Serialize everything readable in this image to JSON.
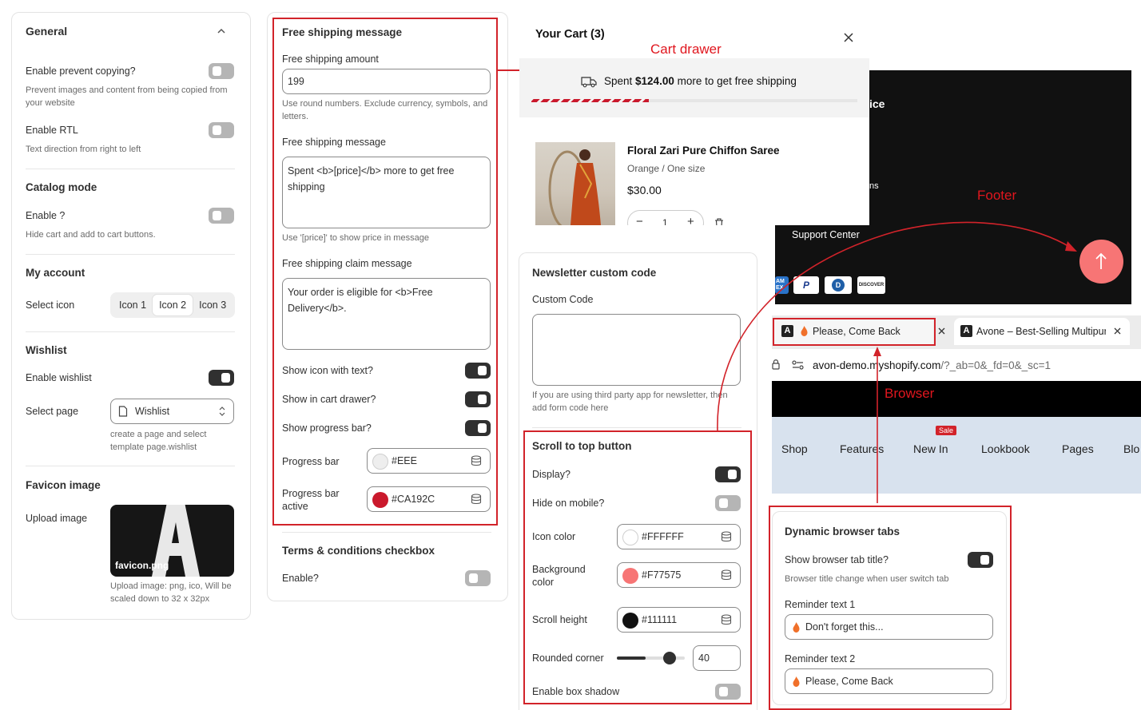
{
  "general": {
    "title": "General",
    "prevent_copy_label": "Enable prevent copying?",
    "prevent_copy_help": "Prevent images and content from being copied from your website",
    "rtl_label": "Enable RTL",
    "rtl_help": "Text direction from right to left"
  },
  "catalog": {
    "title": "Catalog mode",
    "enable_label": "Enable ?",
    "help": "Hide cart and add to cart buttons."
  },
  "account": {
    "title": "My account",
    "select_icon_label": "Select icon",
    "icons": [
      "Icon 1",
      "Icon 2",
      "Icon 3"
    ]
  },
  "wishlist": {
    "title": "Wishlist",
    "enable_label": "Enable wishlist",
    "select_page_label": "Select page",
    "select_value": "Wishlist",
    "help": "create a page and select template page.wishlist"
  },
  "favicon": {
    "title": "Favicon image",
    "upload_label": "Upload image",
    "file_name": "favicon.png",
    "help": "Upload image: png, ico, Will be scaled down to 32 x 32px"
  },
  "free_shipping": {
    "title": "Free shipping message",
    "amount_label": "Free shipping amount",
    "amount_value": "199",
    "amount_help": "Use round numbers. Exclude currency, symbols, and letters.",
    "message_label": "Free shipping message",
    "message_value": "Spent <b>[price]</b> more to get free shipping",
    "message_help": "Use '[price]' to show price in message",
    "claim_label": "Free shipping claim message",
    "claim_value": "Your order is eligible for <b>Free Delivery</b>.",
    "show_icon_label": "Show icon with text?",
    "show_drawer_label": "Show in cart drawer?",
    "show_progress_label": "Show progress bar?",
    "progress_label": "Progress bar",
    "progress_color": "#EEE",
    "progress_active_label": "Progress bar active",
    "progress_active_color": "#CA192C"
  },
  "terms": {
    "title": "Terms & conditions checkbox",
    "enable_label": "Enable?"
  },
  "cart": {
    "title": "Your Cart (3)",
    "annotation": "Cart drawer",
    "spent_prefix": "Spent ",
    "spent_amount": "$124.00",
    "spent_suffix": " more to get free shipping",
    "progress": 0.36,
    "product_name": "Floral Zari Pure Chiffon Saree",
    "variant": "Orange / One size",
    "price": "$30.00",
    "qty": "1"
  },
  "footer": {
    "annotation": "Footer",
    "text_ice": "ice",
    "text_ns": "ns",
    "support": "Support Center",
    "payments": [
      "AM EX",
      "P",
      "D",
      "DISCOVER"
    ]
  },
  "newsletter": {
    "title": "Newsletter custom code",
    "label": "Custom Code",
    "help": "If you are using third party app for newsletter, then add form code here"
  },
  "scroll_top": {
    "title": "Scroll to top button",
    "display_label": "Display?",
    "hide_mobile_label": "Hide on mobile?",
    "icon_color_label": "Icon color",
    "icon_color": "#FFFFFF",
    "bg_color_label": "Background color",
    "bg_color": "#F77575",
    "scroll_height_label": "Scroll height",
    "scroll_height_color": "#111111",
    "rounded_label": "Rounded corner",
    "rounded_value": "40",
    "rounded_fraction": 0.42,
    "shadow_label": "Enable box shadow"
  },
  "browser": {
    "annotation": "Browser",
    "tab1": "Please, Come Back",
    "tab2": "Avone – Best-Selling Multipurp",
    "url_host": "avon-demo.myshopify.com",
    "url_path": "/?_ab=0&_fd=0&_sc=1",
    "nav": [
      "Shop",
      "Features",
      "New In",
      "Lookbook",
      "Pages",
      "Blo"
    ],
    "sale_badge": "Sale"
  },
  "dynamic_tabs": {
    "title": "Dynamic browser tabs",
    "show_label": "Show browser tab title?",
    "help": "Browser title change when user switch tab",
    "r1_label": "Reminder text 1",
    "r1_value": "Don't forget this...",
    "r2_label": "Reminder text 2",
    "r2_value": "Please, Come Back"
  },
  "colors": {
    "accent_red": "#D2232A",
    "progress_active": "#CA192C",
    "scroll_btn": "#F77575"
  }
}
